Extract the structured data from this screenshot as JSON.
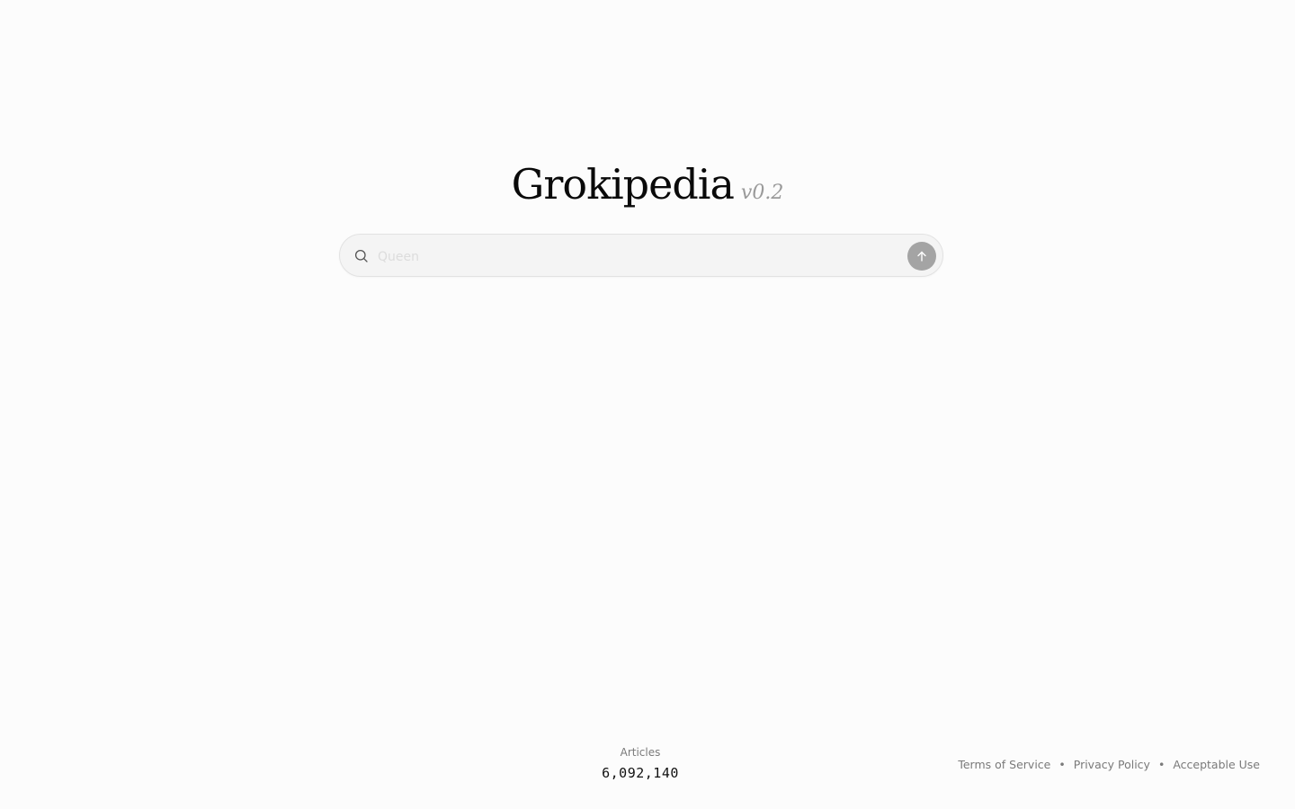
{
  "logo": {
    "name": "Grokipedia",
    "version": "v0.2"
  },
  "search": {
    "placeholder": "Queen",
    "value": "",
    "icon": "search-icon",
    "submit_icon": "arrow-up-icon"
  },
  "stats": {
    "label": "Articles",
    "value": "6,092,140"
  },
  "footer": {
    "links": [
      "Terms of Service",
      "Privacy Policy",
      "Acceptable Use"
    ],
    "separator": "•"
  },
  "colors": {
    "background": "#fcfcfc",
    "submit_button": "#a4a4a4",
    "muted_text": "#7a7a7a"
  }
}
